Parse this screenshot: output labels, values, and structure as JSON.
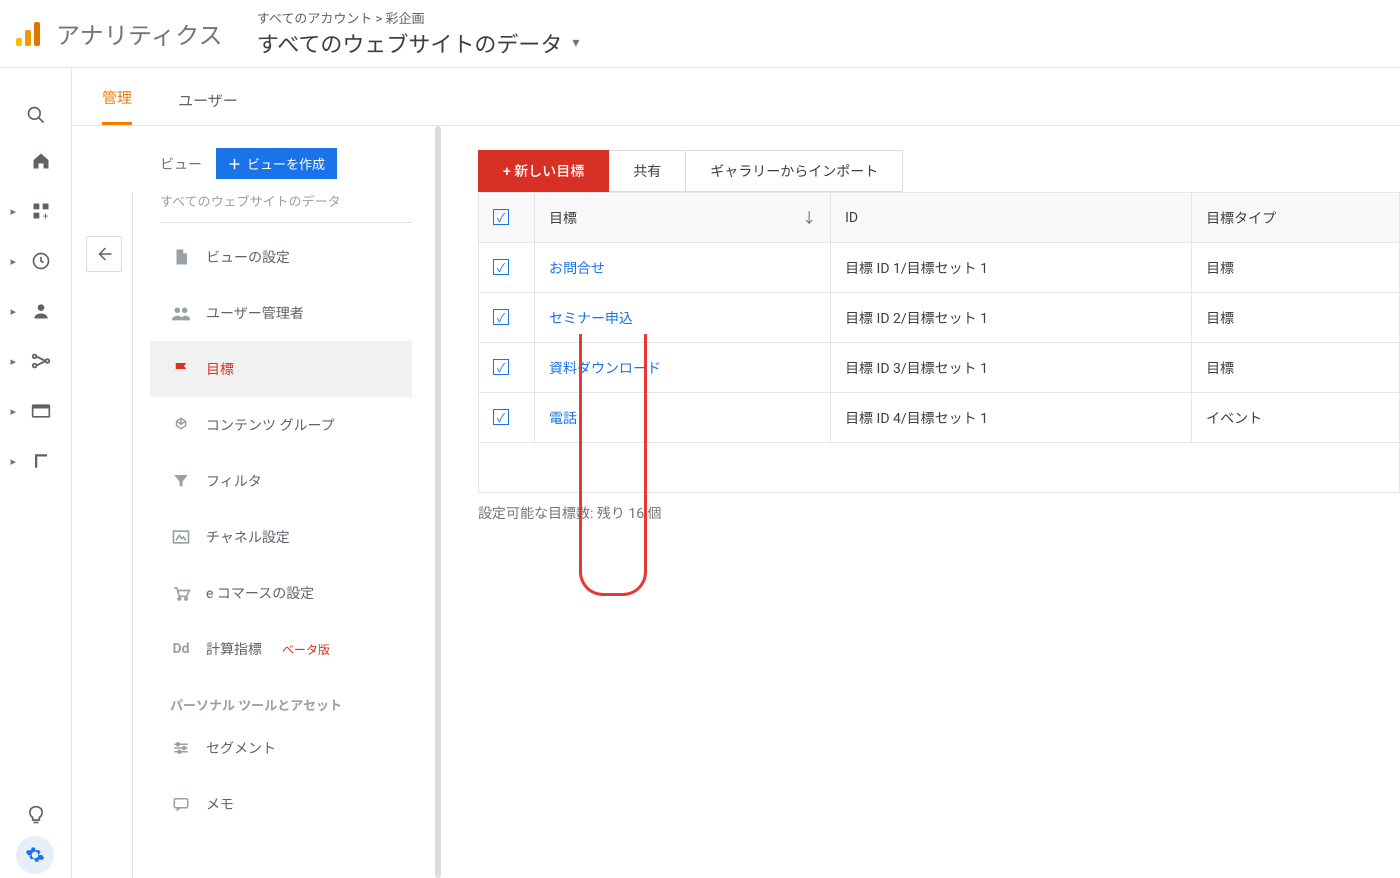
{
  "header": {
    "brand": "アナリティクス",
    "breadcrumb": "すべてのアカウント > 彩企画",
    "view_title": "すべてのウェブサイトのデータ"
  },
  "tabs": {
    "admin": "管理",
    "user": "ユーザー"
  },
  "sidebar_column": {
    "label": "ビュー",
    "create_button": "ビューを作成",
    "view_name": "すべてのウェブサイトのデータ",
    "section_header": "パーソナル ツールとアセット",
    "items": {
      "view_settings": "ビューの設定",
      "user_admin": "ユーザー管理者",
      "goals": "目標",
      "content_group": "コンテンツ グループ",
      "filter": "フィルタ",
      "channel": "チャネル設定",
      "ecommerce": "e コマースの設定",
      "calc_metric": "計算指標",
      "calc_beta": "ベータ版",
      "segment": "セグメント",
      "memo": "メモ"
    }
  },
  "toolbar": {
    "new_goal": "+ 新しい目標",
    "share": "共有",
    "import": "ギャラリーからインポート"
  },
  "table": {
    "headers": {
      "goal": "目標",
      "id": "ID",
      "type": "目標タイプ"
    },
    "rows": [
      {
        "name": "お問合せ",
        "id": "目標 ID 1/目標セット 1",
        "type": "目標"
      },
      {
        "name": "セミナー申込",
        "id": "目標 ID 2/目標セット 1",
        "type": "目標"
      },
      {
        "name": "資料ダウンロード",
        "id": "目標 ID 3/目標セット 1",
        "type": "目標"
      },
      {
        "name": "電話",
        "id": "目標 ID 4/目標セット 1",
        "type": "イベント"
      }
    ]
  },
  "footer_note": "設定可能な目標数: 残り 16 個"
}
